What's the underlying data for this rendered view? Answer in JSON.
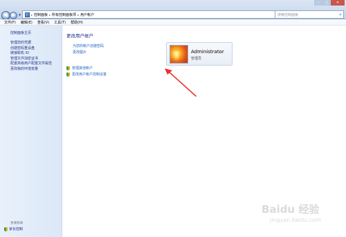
{
  "window": {
    "minimize_glyph": "–",
    "maximize_glyph": "□",
    "close_glyph": "✕"
  },
  "address": {
    "breadcrumbs": [
      "控制面板",
      "所有控制面板项",
      "用户帐户"
    ],
    "search_placeholder": "搜索控制面板"
  },
  "menu": [
    "文件(F)",
    "编辑(E)",
    "查看(V)",
    "工具(T)",
    "帮助(H)"
  ],
  "sidebar": {
    "home": "控制面板主页",
    "items": [
      "管理您的凭据",
      "创建密码重设盘",
      "链接联机 ID",
      "管理文件加密证书",
      "配置高级用户配置文件属性",
      "更改我的环境变量"
    ],
    "see_also": "另请参阅",
    "parental_controls": "家长控制"
  },
  "main": {
    "title": "更改用户帐户",
    "tasks": [
      "为您的帐户创建密码",
      "更改图片"
    ],
    "uac_links": [
      "管理其他帐户",
      "更改用户帐户控制设置"
    ],
    "account": {
      "name": "Administrator",
      "role": "管理员"
    }
  },
  "watermark": {
    "main": "Baidu 经验",
    "sub": "jingyan.baidu.com"
  },
  "colors": {
    "link": "#1e63c8",
    "heading": "#1e3287",
    "annotation_arrow": "#e8322e"
  }
}
